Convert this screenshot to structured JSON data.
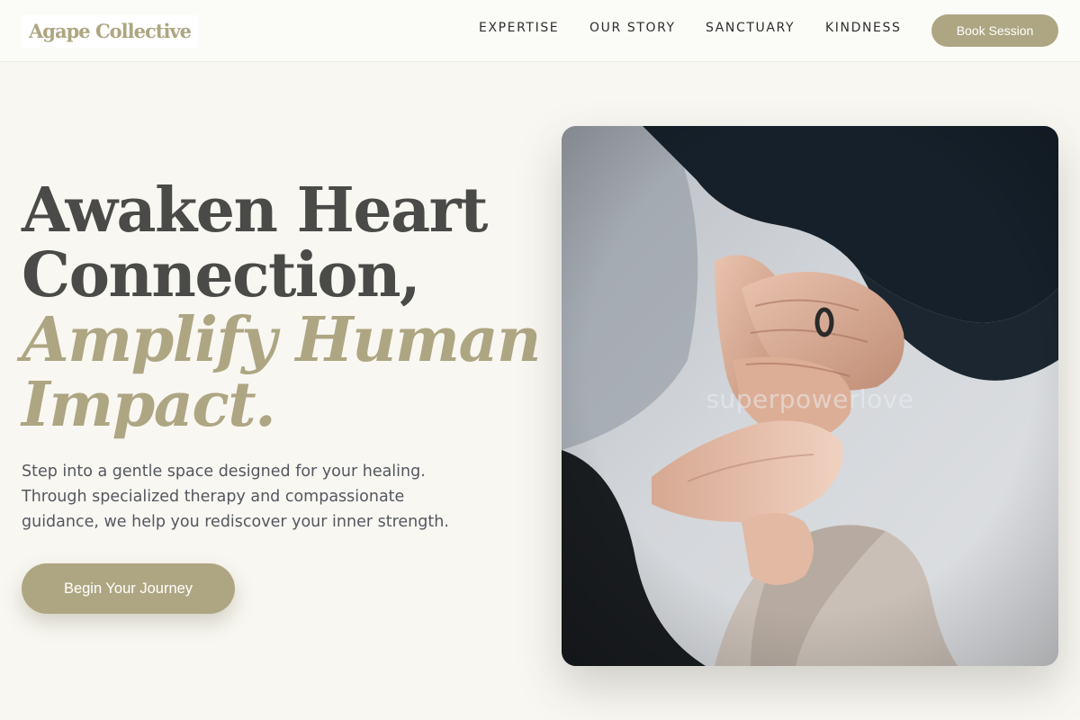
{
  "brand": {
    "name": "Agape Collective"
  },
  "nav": {
    "items": [
      {
        "label": "EXPERTISE"
      },
      {
        "label": "OUR STORY"
      },
      {
        "label": "SANCTUARY"
      },
      {
        "label": "KINDNESS"
      }
    ],
    "cta_label": "Book Session"
  },
  "hero": {
    "title_line1": "Awaken Heart",
    "title_line2": "Connection,",
    "title_accent1": "Amplify Human",
    "title_accent2": "Impact.",
    "subtitle": "Step into a gentle space designed for your healing. Through specialized therapy and compassionate guidance, we help you rediscover your inner strength.",
    "cta_label": "Begin Your Journey"
  },
  "photo": {
    "watermark": "superpowerlove"
  },
  "colors": {
    "accent": "#aea682",
    "background": "#f8f7f2",
    "heading": "#4a4a48",
    "body_text": "#555760"
  }
}
